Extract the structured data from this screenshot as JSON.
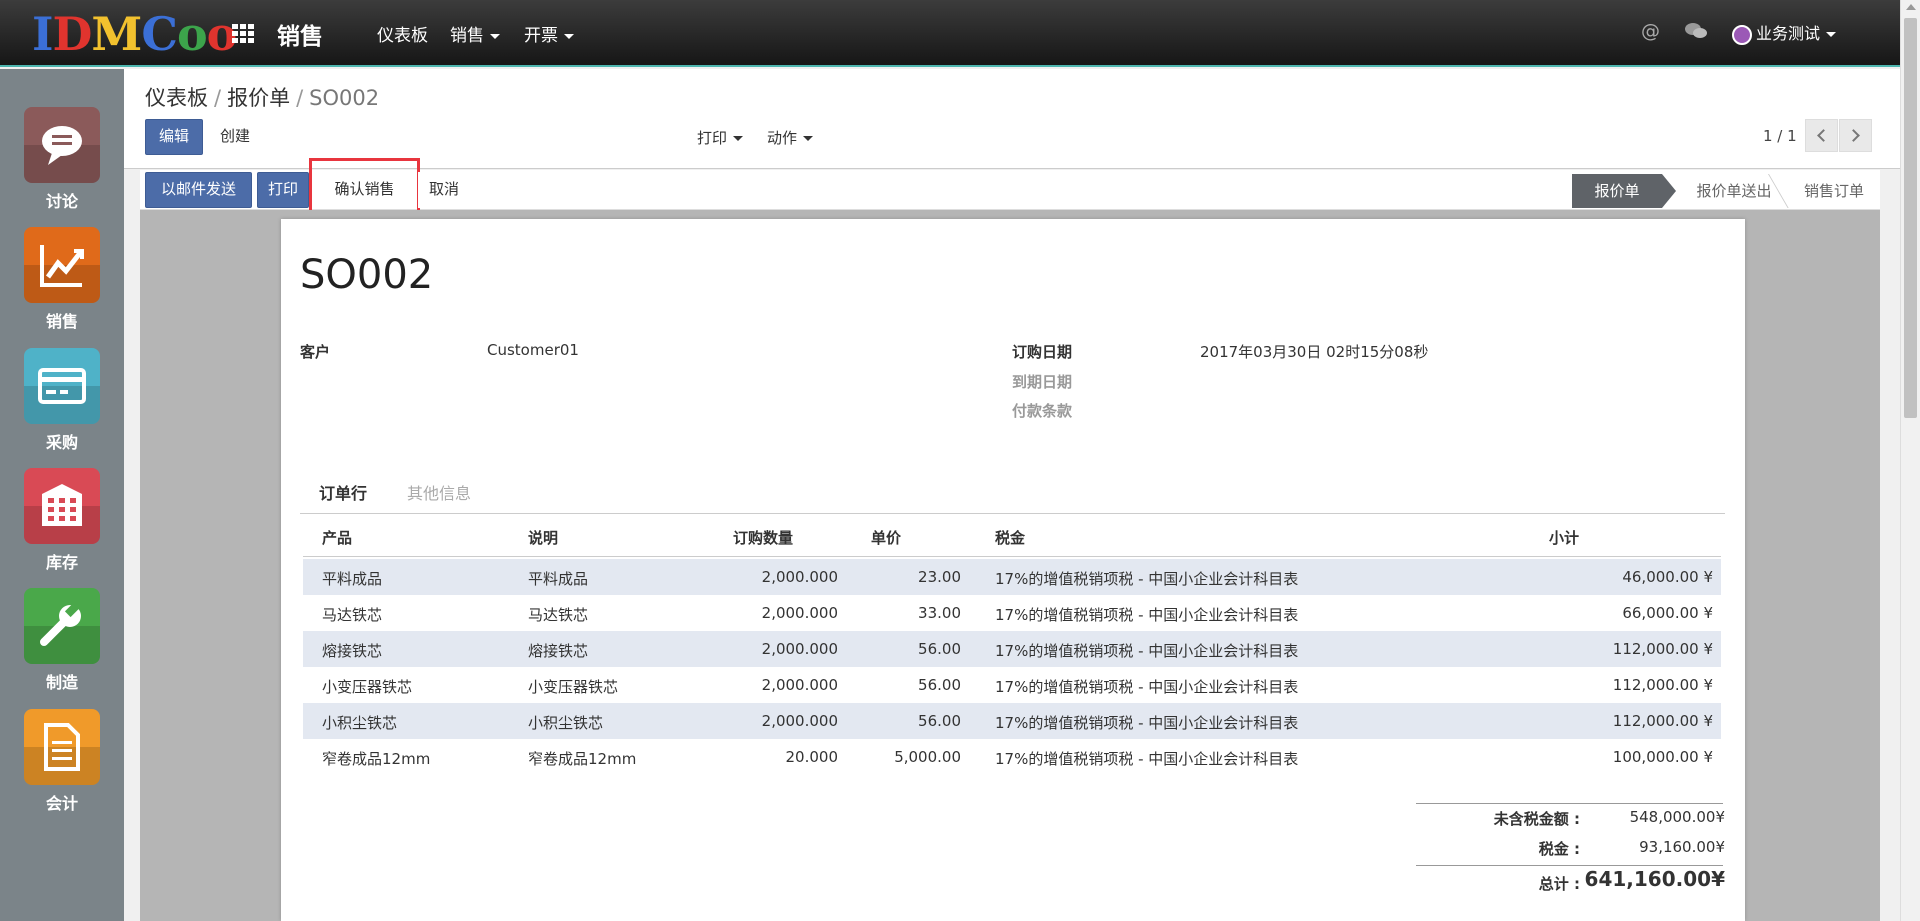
{
  "brand": {
    "logo_letters": [
      "I",
      "D",
      "M",
      "C",
      "o",
      "o"
    ],
    "logo_colors": [
      "#3b6fd6",
      "#e0342e",
      "#f2c12e",
      "#3b6fd6",
      "#3ca44b",
      "#e0342e"
    ],
    "app_title": "销售"
  },
  "topmenu": {
    "dashboard": "仪表板",
    "sales": "销售",
    "invoicing": "开票"
  },
  "user": {
    "name": "业务测试"
  },
  "sidebar": [
    {
      "label": "讨论",
      "icon": "chat-bubble-icon",
      "color": "#8b5a5a"
    },
    {
      "label": "销售",
      "icon": "line-chart-icon",
      "color": "#e06a1a"
    },
    {
      "label": "采购",
      "icon": "credit-card-icon",
      "color": "#4fb2c8"
    },
    {
      "label": "库存",
      "icon": "warehouse-icon",
      "color": "#d94a55"
    },
    {
      "label": "制造",
      "icon": "wrench-icon",
      "color": "#4aa84a"
    },
    {
      "label": "会计",
      "icon": "document-icon",
      "color": "#f09a2a"
    }
  ],
  "breadcrumb": {
    "dashboard": "仪表板",
    "quotations": "报价单",
    "current": "SO002"
  },
  "toolbar": {
    "edit": "编辑",
    "create": "创建",
    "print": "打印",
    "action": "动作",
    "pager": "1 / 1"
  },
  "statusbar": {
    "send_email": "以邮件发送",
    "print": "打印",
    "confirm_sale": "确认销售",
    "cancel": "取消",
    "stages": [
      "报价单",
      "报价单送出",
      "销售订单"
    ]
  },
  "order": {
    "name": "SO002",
    "customer_label": "客户",
    "customer": "Customer01",
    "order_date_label": "订购日期",
    "order_date": "2017年03月30日 02时15分08秒",
    "due_date_label": "到期日期",
    "payment_terms_label": "付款条款"
  },
  "tabs": {
    "order_lines": "订单行",
    "other_info": "其他信息"
  },
  "table": {
    "headers": {
      "product": "产品",
      "description": "说明",
      "qty": "订购数量",
      "price": "单价",
      "tax": "税金",
      "subtotal": "小计"
    },
    "rows": [
      {
        "product": "平料成品",
        "description": "平料成品",
        "qty": "2,000.000",
        "price": "23.00",
        "tax": "17%的增值税销项税 - 中国小企业会计科目表",
        "subtotal": "46,000.00 ¥"
      },
      {
        "product": "马达铁芯",
        "description": "马达铁芯",
        "qty": "2,000.000",
        "price": "33.00",
        "tax": "17%的增值税销项税 - 中国小企业会计科目表",
        "subtotal": "66,000.00 ¥"
      },
      {
        "product": "熔接铁芯",
        "description": "熔接铁芯",
        "qty": "2,000.000",
        "price": "56.00",
        "tax": "17%的增值税销项税 - 中国小企业会计科目表",
        "subtotal": "112,000.00 ¥"
      },
      {
        "product": "小变压器铁芯",
        "description": "小变压器铁芯",
        "qty": "2,000.000",
        "price": "56.00",
        "tax": "17%的增值税销项税 - 中国小企业会计科目表",
        "subtotal": "112,000.00 ¥"
      },
      {
        "product": "小积尘铁芯",
        "description": "小积尘铁芯",
        "qty": "2,000.000",
        "price": "56.00",
        "tax": "17%的增值税销项税 - 中国小企业会计科目表",
        "subtotal": "112,000.00 ¥"
      },
      {
        "product": "窄卷成品12mm",
        "description": "窄卷成品12mm",
        "qty": "20.000",
        "price": "5,000.00",
        "tax": "17%的增值税销项税 - 中国小企业会计科目表",
        "subtotal": "100,000.00 ¥"
      }
    ]
  },
  "totals": {
    "untaxed_label": "未含税金额 :",
    "untaxed": "548,000.00¥",
    "tax_label": "税金 :",
    "tax": "93,160.00¥",
    "total_label": "总计 :",
    "total": "641,160.00¥"
  }
}
